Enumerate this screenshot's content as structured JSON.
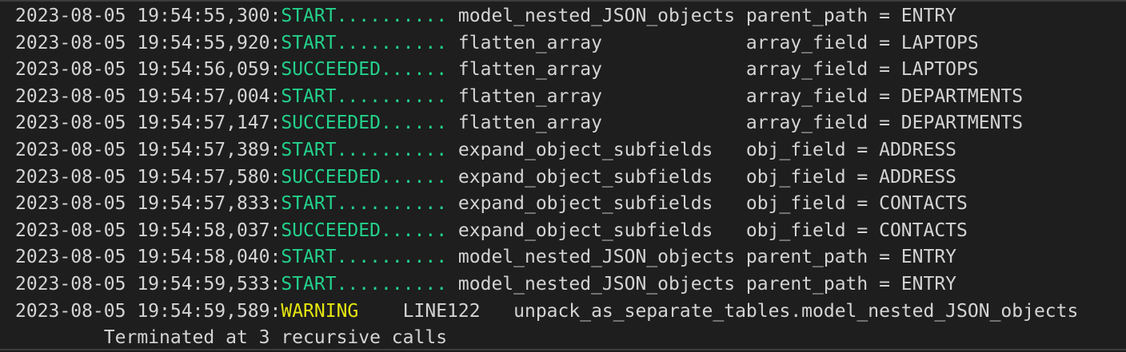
{
  "colors": {
    "background": "#1e1e1e",
    "text": "#d4d4d4",
    "status_ok": "#23d18b",
    "status_warning": "#e5e510"
  },
  "log_lines": [
    {
      "timestamp": "2023-08-05 19:54:55,300:",
      "status": "START..........",
      "message": " model_nested_JSON_objects parent_path = ENTRY"
    },
    {
      "timestamp": "2023-08-05 19:54:55,920:",
      "status": "START..........",
      "message": " flatten_array             array_field = LAPTOPS"
    },
    {
      "timestamp": "2023-08-05 19:54:56,059:",
      "status": "SUCCEEDED......",
      "message": " flatten_array             array_field = LAPTOPS"
    },
    {
      "timestamp": "2023-08-05 19:54:57,004:",
      "status": "START..........",
      "message": " flatten_array             array_field = DEPARTMENTS"
    },
    {
      "timestamp": "2023-08-05 19:54:57,147:",
      "status": "SUCCEEDED......",
      "message": " flatten_array             array_field = DEPARTMENTS"
    },
    {
      "timestamp": "2023-08-05 19:54:57,389:",
      "status": "START..........",
      "message": " expand_object_subfields   obj_field = ADDRESS"
    },
    {
      "timestamp": "2023-08-05 19:54:57,580:",
      "status": "SUCCEEDED......",
      "message": " expand_object_subfields   obj_field = ADDRESS"
    },
    {
      "timestamp": "2023-08-05 19:54:57,833:",
      "status": "START..........",
      "message": " expand_object_subfields   obj_field = CONTACTS"
    },
    {
      "timestamp": "2023-08-05 19:54:58,037:",
      "status": "SUCCEEDED......",
      "message": " expand_object_subfields   obj_field = CONTACTS"
    },
    {
      "timestamp": "2023-08-05 19:54:58,040:",
      "status": "START..........",
      "message": " model_nested_JSON_objects parent_path = ENTRY"
    },
    {
      "timestamp": "2023-08-05 19:54:59,533:",
      "status": "START..........",
      "message": " model_nested_JSON_objects parent_path = ENTRY"
    },
    {
      "timestamp": "2023-08-05 19:54:59,589:",
      "status": "WARNING",
      "message": "    LINE122   unpack_as_separate_tables.model_nested_JSON_objects"
    }
  ],
  "continuation": "        Terminated at 3 recursive calls"
}
